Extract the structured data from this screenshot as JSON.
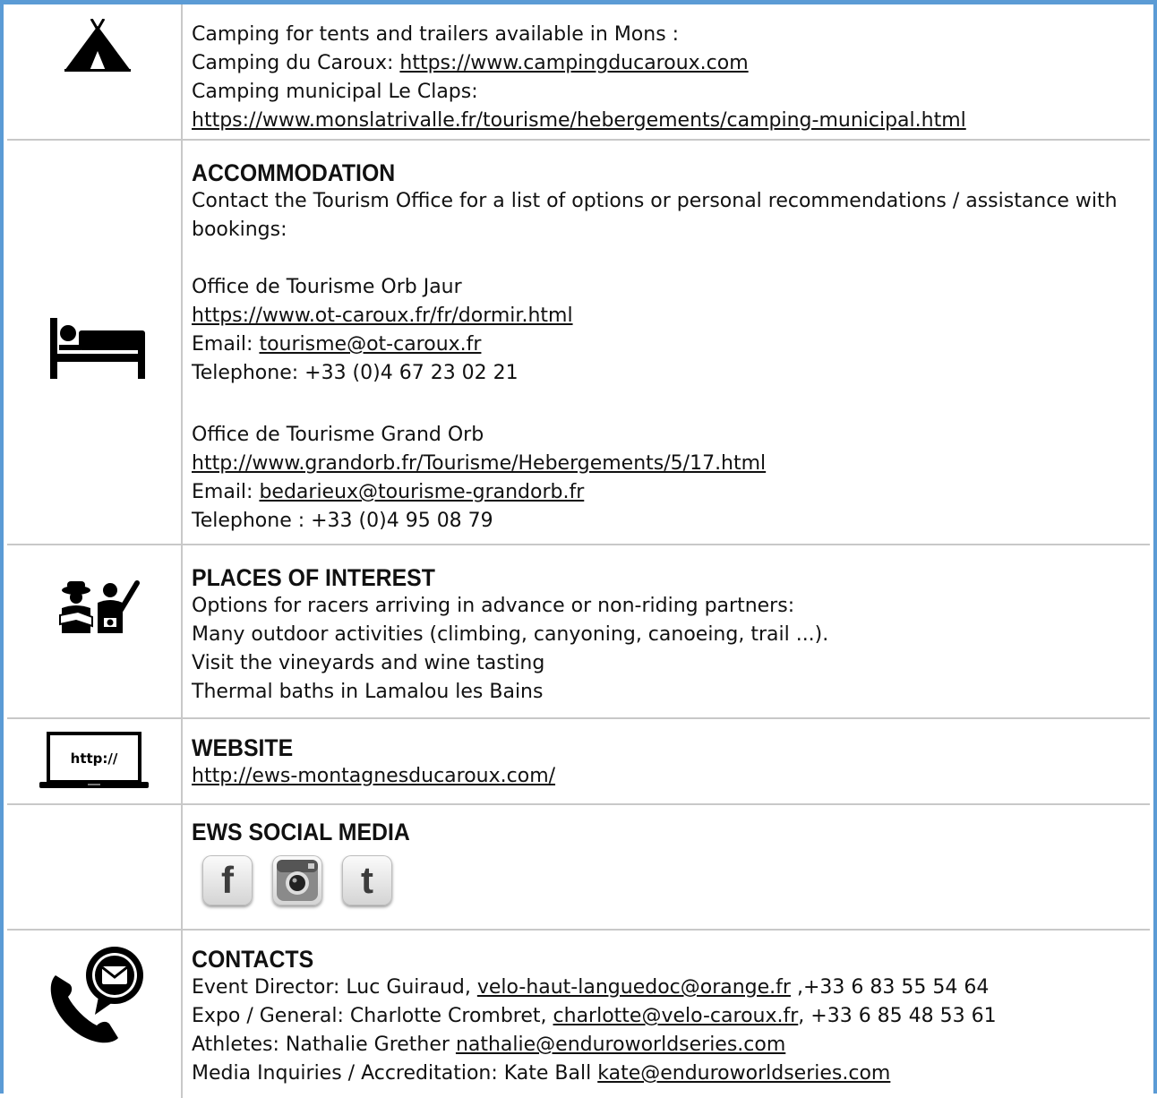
{
  "rows": {
    "camping": {
      "icon": "tent-icon",
      "lines": [
        "Camping for tents and trailers available in Mons :",
        "Camping du Caroux: "
      ],
      "link1": "https://www.campingducaroux.com",
      "line3": "Camping municipal Le Claps:",
      "link2": "https://www.monslatrivalle.fr/tourisme/hebergements/camping-municipal.html"
    },
    "accommodation": {
      "icon": "bed-icon",
      "heading": "ACCOMMODATION",
      "intro": "Contact the Tourism Office for a list of options or personal recommendations / assistance with bookings:",
      "office1": {
        "name": "Office de Tourisme Orb Jaur",
        "url": "https://www.ot-caroux.fr/fr/dormir.html",
        "email_label": "Email: ",
        "email": "tourisme@ot-caroux.fr",
        "phone": "Telephone: +33 (0)4 67 23 02 21"
      },
      "office2": {
        "name": "Office de Tourisme Grand Orb",
        "url": "http://www.grandorb.fr/Tourisme/Hebergements/5/17.html",
        "email_label": "Email: ",
        "email": "bedarieux@tourisme-grandorb.fr",
        "phone": "Telephone : +33 (0)4 95 08 79"
      }
    },
    "places": {
      "icon": "tourists-icon",
      "heading": "PLACES OF INTEREST",
      "lines": [
        "Options for racers arriving in advance or non-riding partners:",
        "Many outdoor activities (climbing, canyoning, canoeing, trail ...).",
        "Visit the vineyards and wine tasting",
        "Thermal baths in Lamalou les Bains"
      ]
    },
    "website": {
      "icon": "laptop-icon",
      "icon_text": "http://",
      "heading": "WEBSITE",
      "url": "http://ews-montagnesducaroux.com/"
    },
    "social": {
      "heading": "EWS SOCIAL MEDIA",
      "icons": [
        "facebook-icon",
        "instagram-icon",
        "twitter-icon"
      ],
      "facebook_glyph": "f",
      "twitter_glyph": "t"
    },
    "contacts": {
      "icon": "phone-mail-icon",
      "heading": "CONTACTS",
      "c1_pre": "Event Director: Luc Guiraud, ",
      "c1_email": "velo-haut-languedoc@orange.fr",
      "c1_post": " ,+33 6 83 55 54 64",
      "c2_pre": "Expo / General: Charlotte Crombret, ",
      "c2_email": "charlotte@velo-caroux.fr",
      "c2_post": ", +33 6 85 48 53 61",
      "c3_pre": "Athletes: Nathalie Grether ",
      "c3_email": "nathalie@enduroworldseries.com",
      "c4_pre": "Media Inquiries / Accreditation: Kate Ball ",
      "c4_email": "kate@enduroworldseries.com"
    }
  },
  "colors": {
    "frame_border": "#5b9bd5",
    "grid_line": "#c8c8c8",
    "text": "#111111"
  }
}
